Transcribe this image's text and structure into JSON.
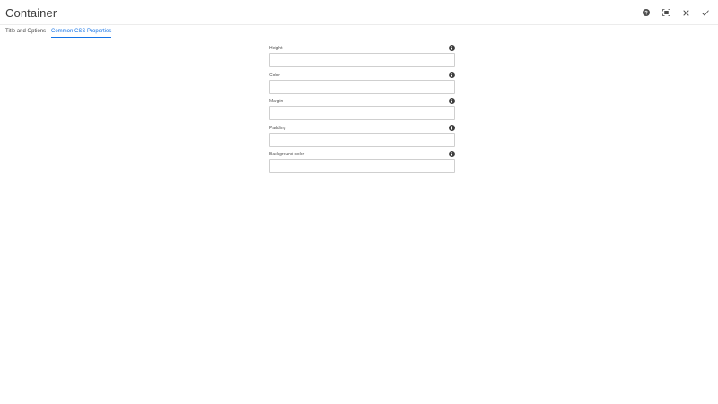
{
  "header": {
    "title": "Container",
    "actions": [
      {
        "name": "help",
        "icon": "help-icon"
      },
      {
        "name": "fullscreen",
        "icon": "fullscreen-icon"
      },
      {
        "name": "close",
        "icon": "close-icon"
      },
      {
        "name": "done",
        "icon": "checkmark-icon"
      }
    ]
  },
  "tabs": [
    {
      "label": "Title and Options",
      "active": false
    },
    {
      "label": "Common CSS Properties",
      "active": true
    }
  ],
  "form": {
    "fields": [
      {
        "label": "Height",
        "value": "",
        "info_icon": "info-icon"
      },
      {
        "label": "Color",
        "value": "",
        "info_icon": "info-icon"
      },
      {
        "label": "Margin",
        "value": "",
        "info_icon": "info-icon"
      },
      {
        "label": "Padding",
        "value": "",
        "info_icon": "info-icon"
      },
      {
        "label": "Background-color",
        "value": "",
        "info_icon": "info-icon"
      }
    ]
  },
  "colors": {
    "accent": "#1473e6",
    "icon": "#4b4b4b",
    "border": "#cfcfcf"
  }
}
